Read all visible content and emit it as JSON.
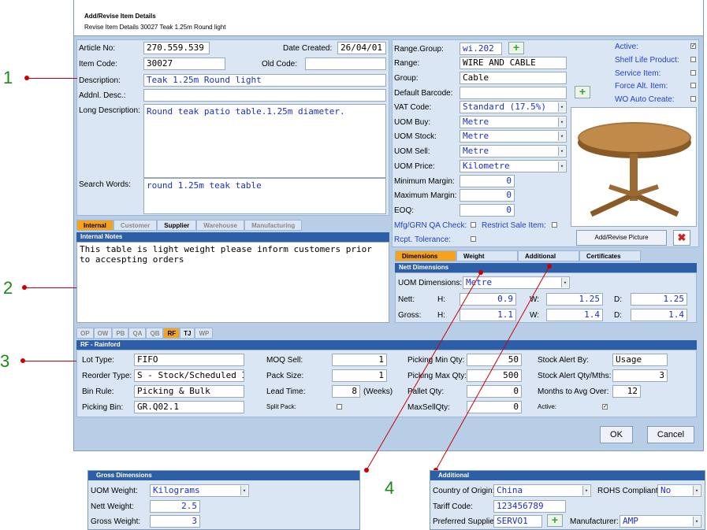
{
  "title": "Add/Revise Item Details",
  "subtitle": "Revise Item Details 30027 Teak 1.25m Round light",
  "left": {
    "article_no_label": "Article No:",
    "article_no": "270.559.539",
    "date_created_label": "Date Created:",
    "date_created": "26/04/01",
    "item_code_label": "Item Code:",
    "item_code": "30027",
    "old_code_label": "Old Code:",
    "old_code": "",
    "description_label": "Description:",
    "description": "Teak 1.25m Round light",
    "addnl_desc_label": "Addnl. Desc.:",
    "addnl_desc": "",
    "long_desc_label": "Long Description:",
    "long_desc": "Round teak patio table.1.25m diameter.",
    "search_words_label": "Search Words:",
    "search_words": "round 1.25m teak table"
  },
  "right": {
    "range_group_label": "Range.Group:",
    "range_group": "wi.202",
    "range_label": "Range:",
    "range": "WIRE AND CABLE",
    "group_label": "Group:",
    "group": "Cable",
    "barcode_label": "Default Barcode:",
    "barcode": "",
    "vat_label": "VAT Code:",
    "vat": "Standard (17.5%)",
    "uom_buy_label": "UOM Buy:",
    "uom_buy": "Metre",
    "uom_stock_label": "UOM Stock:",
    "uom_stock": "Metre",
    "uom_sell_label": "UOM Sell:",
    "uom_sell": "Metre",
    "uom_price_label": "UOM Price:",
    "uom_price": "Kilometre",
    "min_margin_label": "Minimum Margin:",
    "min_margin": "0",
    "max_margin_label": "Maximum Margin:",
    "max_margin": "0",
    "eoq_label": "EOQ:",
    "eoq": "0",
    "mfg_qa_label": "Mfg/GRN QA Check:",
    "restrict_label": "Restrict Sale Item:",
    "rcpt_label": "Rcpt. Tolerance:",
    "flags": [
      {
        "label": "Active:",
        "checked": "✓"
      },
      {
        "label": "Shelf Life Product:",
        "checked": ""
      },
      {
        "label": "Service Item:",
        "checked": ""
      },
      {
        "label": "Force Alt. Item:",
        "checked": ""
      },
      {
        "label": "WO Auto Create:",
        "checked": ""
      }
    ],
    "picture_button": "Add/Revise Picture"
  },
  "notes_tabs": [
    "Internal",
    "Customer",
    "Supplier",
    "Warehouse",
    "Manufacturing"
  ],
  "notes_header": "Internal Notes",
  "notes_text": "This table is light weight please inform customers prior to accespting orders",
  "dim_tabs": [
    "Dimensions",
    "Weight",
    "Additional",
    "Certificates"
  ],
  "dim_header": "Nett Dimensions",
  "dims": {
    "uom_label": "UOM Dimensions:",
    "uom": "Metre",
    "nett_label": "Nett:",
    "gross_label": "Gross:",
    "h_label": "H:",
    "w_label": "W:",
    "d_label": "D:",
    "nett_h": "0.9",
    "nett_w": "1.25",
    "nett_d": "1.25",
    "gross_h": "1.1",
    "gross_w": "1.4",
    "gross_d": "1.4"
  },
  "wh_tabs": [
    "OP",
    "OW",
    "PB",
    "QA",
    "QB",
    "RF",
    "TJ",
    "WP"
  ],
  "wh_header": "RF - Rainford",
  "wh": {
    "lot_type_label": "Lot Type:",
    "lot_type": "FIFO",
    "reorder_label": "Reorder Type:",
    "reorder": "S - Stock/Scheduled Ite",
    "bin_rule_label": "Bin Rule:",
    "bin_rule": "Picking & Bulk",
    "picking_bin_label": "Picking Bin:",
    "picking_bin": "GR.Q02.1",
    "moq_label": "MOQ Sell:",
    "moq": "1",
    "pack_label": "Pack Size:",
    "pack": "1",
    "lead_label": "Lead Time:",
    "lead": "8",
    "lead_unit": "(Weeks)",
    "split_label": "Split Pack:",
    "pick_min_label": "Picking Min Qty:",
    "pick_min": "50",
    "pick_max_label": "Picking Max Qty:",
    "pick_max": "500",
    "pallet_label": "Pallet Qty:",
    "pallet": "0",
    "maxsell_label": "MaxSellQty:",
    "maxsell": "0",
    "alert_by_label": "Stock Alert By:",
    "alert_by": "Usage",
    "alert_qty_label": "Stock Alert Qty/Mths:",
    "alert_qty": "3",
    "months_label": "Months to Avg Over:",
    "months": "12",
    "active_label": "Active:",
    "active": "✓"
  },
  "ok": "OK",
  "cancel": "Cancel",
  "gross_panel": {
    "header": "Gross Dimensions",
    "uom_weight_label": "UOM Weight:",
    "uom_weight": "Kilograms",
    "nett_weight_label": "Nett Weight:",
    "nett_weight": "2.5",
    "gross_weight_label": "Gross Weight:",
    "gross_weight": "3"
  },
  "additional_panel": {
    "header": "Additional",
    "country_label": "Country of Origin:",
    "country": "China",
    "rohs_label": "ROHS Compliant:",
    "rohs": "No",
    "tariff_label": "Tariff Code:",
    "tariff": "123456789",
    "supplier_label": "Preferred Supplier:",
    "supplier": "SERVO1",
    "manufacturer_label": "Manufacturer:",
    "manufacturer": "AMP"
  },
  "callouts": [
    "1",
    "2",
    "3",
    "4"
  ]
}
